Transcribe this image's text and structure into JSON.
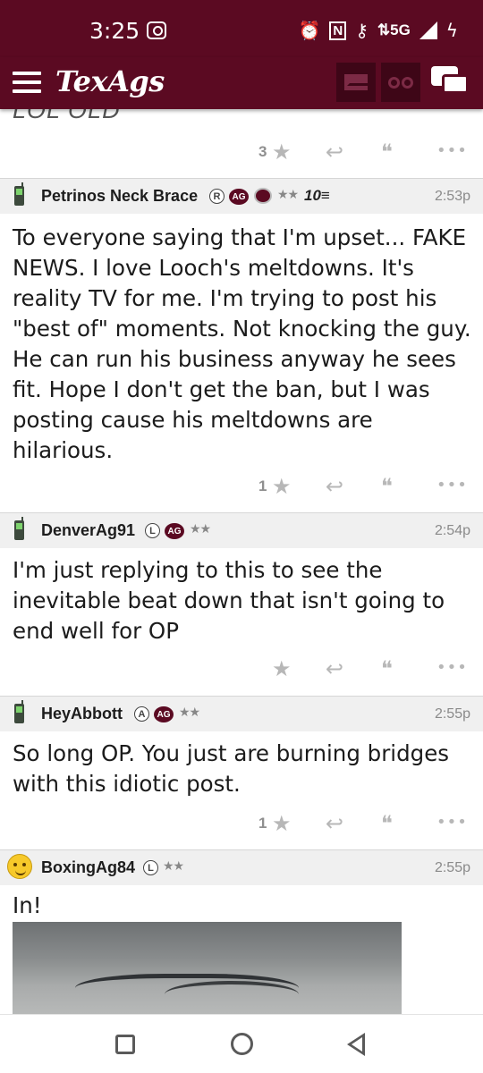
{
  "status_bar": {
    "time": "3:25",
    "network": "5G",
    "icons": [
      "screen-record-icon",
      "alarm-icon",
      "nfc-icon",
      "vpn-key-icon",
      "data-arrows-icon",
      "signal-icon",
      "charging-icon"
    ]
  },
  "app_bar": {
    "logo": "TexAgs",
    "icons": [
      "menu-icon",
      "mail-icon",
      "binoculars-icon",
      "chat-icon"
    ],
    "accent_color": "#5b0a22"
  },
  "previous_post": {
    "partial_text": "LOL OLD",
    "star_count": "3"
  },
  "posts": [
    {
      "username": "Petrinos Neck Brace",
      "badge_letter": "R",
      "ag_badge": "AG",
      "stars": "★★",
      "extra_badge": "10",
      "time": "2:53p",
      "body": "To everyone saying that I'm upset... FAKE NEWS. I love Looch's meltdowns. It's reality TV for me. I'm trying to post his \"best of\" moments. Not knocking the guy. He can run his business anyway he sees fit. Hope I don't get the ban, but I was posting cause his meltdowns are hilarious.",
      "star_count": "1"
    },
    {
      "username": "DenverAg91",
      "badge_letter": "L",
      "ag_badge": "AG",
      "stars": "★★",
      "time": "2:54p",
      "body": "I'm just replying to this to see the inevitable beat down that isn't going to end well for OP",
      "star_count": ""
    },
    {
      "username": "HeyAbbott",
      "badge_letter": "A",
      "ag_badge": "AG",
      "stars": "★★",
      "time": "2:55p",
      "body": "So long OP. You just are burning bridges with this idiotic post.",
      "star_count": "1"
    },
    {
      "username": "BoxingAg84",
      "badge_letter": "L",
      "stars": "★★",
      "time": "2:55p",
      "body": "In!"
    }
  ],
  "action_icons": {
    "star": "★",
    "reply": "↩",
    "quote": "❝",
    "more": "•••"
  }
}
